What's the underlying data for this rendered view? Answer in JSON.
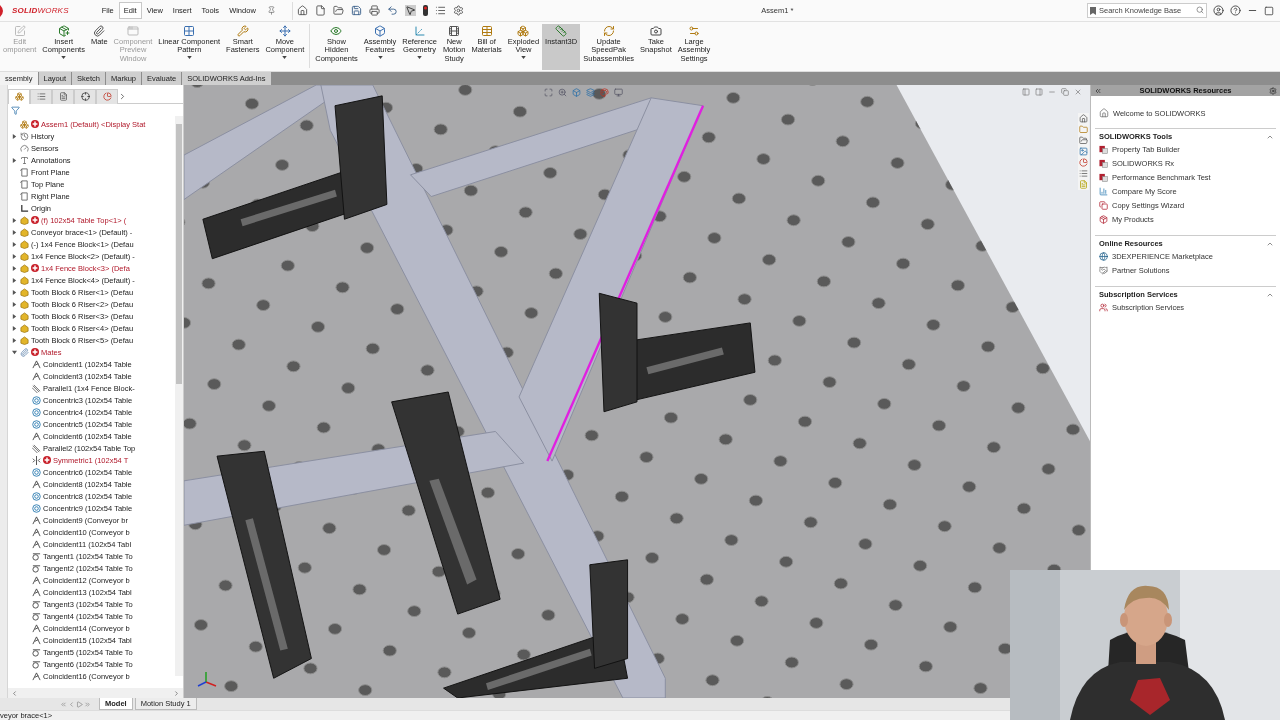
{
  "app": {
    "logo": "**SOLID**WORKS",
    "title": "Assem1 *"
  },
  "menu": [
    {
      "label": "File",
      "selected": false
    },
    {
      "label": "Edit",
      "selected": true
    },
    {
      "label": "View",
      "selected": false
    },
    {
      "label": "Insert",
      "selected": false
    },
    {
      "label": "Tools",
      "selected": false
    },
    {
      "label": "Window",
      "selected": false
    }
  ],
  "search": {
    "placeholder": "Search Knowledge Base"
  },
  "ribbon": [
    {
      "label": "Edit\nomponent",
      "disabled": true,
      "selected": false,
      "dropdown": false
    },
    {
      "label": "Insert\nComponents",
      "disabled": false,
      "selected": false,
      "dropdown": true
    },
    {
      "label": "Mate",
      "disabled": false,
      "selected": false,
      "dropdown": false
    },
    {
      "label": "Component\nPreview\nWindow",
      "disabled": true,
      "selected": false,
      "dropdown": false
    },
    {
      "label": "Linear Component\nPattern",
      "disabled": false,
      "selected": false,
      "dropdown": true
    },
    {
      "label": "Smart\nFasteners",
      "disabled": false,
      "selected": false,
      "dropdown": false
    },
    {
      "label": "Move\nComponent",
      "disabled": false,
      "selected": false,
      "dropdown": true
    },
    {
      "label": "Show\nHidden\nComponents",
      "disabled": false,
      "selected": false,
      "dropdown": false
    },
    {
      "label": "Assembly\nFeatures",
      "disabled": false,
      "selected": false,
      "dropdown": true
    },
    {
      "label": "Reference\nGeometry",
      "disabled": false,
      "selected": false,
      "dropdown": true
    },
    {
      "label": "New\nMotion\nStudy",
      "disabled": false,
      "selected": false,
      "dropdown": false
    },
    {
      "label": "Bill of\nMaterials",
      "disabled": false,
      "selected": false,
      "dropdown": false
    },
    {
      "label": "Exploded\nView",
      "disabled": false,
      "selected": false,
      "dropdown": true
    },
    {
      "label": "Instant3D",
      "disabled": false,
      "selected": true,
      "dropdown": false
    },
    {
      "label": "Update\nSpeedPak\nSubassemblies",
      "disabled": false,
      "selected": false,
      "dropdown": false
    },
    {
      "label": "Take\nSnapshot",
      "disabled": false,
      "selected": false,
      "dropdown": false
    },
    {
      "label": "Large\nAssembly\nSettings",
      "disabled": false,
      "selected": false,
      "dropdown": false
    }
  ],
  "tabs": [
    {
      "label": "ssembly",
      "selected": true
    },
    {
      "label": "Layout",
      "selected": false
    },
    {
      "label": "Sketch",
      "selected": false
    },
    {
      "label": "Markup",
      "selected": false
    },
    {
      "label": "Evaluate",
      "selected": false
    },
    {
      "label": "SOLIDWORKS Add-Ins",
      "selected": false
    }
  ],
  "tree_tabs": [
    {
      "selected": true
    },
    {
      "selected": false
    },
    {
      "selected": false
    },
    {
      "selected": false
    },
    {
      "selected": false
    }
  ],
  "tree": {
    "label": "Assem1 (Default) <Display Stat",
    "kind": "assembly",
    "error": true,
    "children": [
      {
        "label": "History",
        "kind": "history",
        "error": false,
        "expanded": false
      },
      {
        "label": "Sensors",
        "kind": "sensors",
        "error": false
      },
      {
        "label": "Annotations",
        "kind": "annotations",
        "error": false,
        "expanded": false
      },
      {
        "label": "Front Plane",
        "kind": "plane",
        "error": false
      },
      {
        "label": "Top Plane",
        "kind": "plane",
        "error": false
      },
      {
        "label": "Right Plane",
        "kind": "plane",
        "error": false
      },
      {
        "label": "Origin",
        "kind": "origin",
        "error": false
      },
      {
        "label": "(f) 102x54 Table Top<1> (",
        "kind": "part",
        "error": true,
        "expanded": false
      },
      {
        "label": "Conveyor brace<1> (Default) -",
        "kind": "part",
        "error": false,
        "expanded": false
      },
      {
        "label": "(-) 1x4 Fence Block<1> (Defau",
        "kind": "part",
        "error": false,
        "expanded": false
      },
      {
        "label": "1x4 Fence Block<2> (Default) -",
        "kind": "part",
        "error": false,
        "expanded": false
      },
      {
        "label": "1x4 Fence Block<3> (Defa",
        "kind": "part",
        "error": true,
        "expanded": false
      },
      {
        "label": "1x4 Fence Block<4> (Default) -",
        "kind": "part",
        "error": false,
        "expanded": false
      },
      {
        "label": "Tooth Block 6 Riser<1> (Defau",
        "kind": "part",
        "error": false,
        "expanded": false
      },
      {
        "label": "Tooth Block 6 Riser<2> (Defau",
        "kind": "part",
        "error": false,
        "expanded": false
      },
      {
        "label": "Tooth Block 6 Riser<3> (Defau",
        "kind": "part",
        "error": false,
        "expanded": false
      },
      {
        "label": "Tooth Block 6 Riser<4> (Defau",
        "kind": "part",
        "error": false,
        "expanded": false
      },
      {
        "label": "Tooth Block 6 Riser<5> (Defau",
        "kind": "part",
        "error": false,
        "expanded": false
      },
      {
        "label": "Mates",
        "kind": "mates",
        "error": true,
        "expanded": true,
        "children": [
          {
            "label": "Coincident1 (102x54 Table",
            "kind": "coincident",
            "error": false
          },
          {
            "label": "Coincident3 (102x54 Table",
            "kind": "coincident",
            "error": false
          },
          {
            "label": "Parallel1 (1x4 Fence Block-",
            "kind": "parallel",
            "error": false
          },
          {
            "label": "Concentric3 (102x54 Table",
            "kind": "concentric",
            "error": false
          },
          {
            "label": "Concentric4 (102x54 Table",
            "kind": "concentric",
            "error": false
          },
          {
            "label": "Concentric5 (102x54 Table",
            "kind": "concentric",
            "error": false
          },
          {
            "label": "Coincident6 (102x54 Table",
            "kind": "coincident",
            "error": false
          },
          {
            "label": "Parallel2 (102x54 Table Top",
            "kind": "parallel",
            "error": false
          },
          {
            "label": "Symmetric1 (102x54 T",
            "kind": "symmetric",
            "error": true
          },
          {
            "label": "Concentric6 (102x54 Table",
            "kind": "concentric",
            "error": false
          },
          {
            "label": "Coincident8 (102x54 Table",
            "kind": "coincident",
            "error": false
          },
          {
            "label": "Concentric8 (102x54 Table",
            "kind": "concentric",
            "error": false
          },
          {
            "label": "Concentric9 (102x54 Table",
            "kind": "concentric",
            "error": false
          },
          {
            "label": "Coincident9 (Conveyor br",
            "kind": "coincident",
            "error": false
          },
          {
            "label": "Coincident10 (Conveyor b",
            "kind": "coincident",
            "error": false
          },
          {
            "label": "Coincident11 (102x54 Tabl",
            "kind": "coincident",
            "error": false
          },
          {
            "label": "Tangent1 (102x54 Table To",
            "kind": "tangent",
            "error": false
          },
          {
            "label": "Tangent2 (102x54 Table To",
            "kind": "tangent",
            "error": false
          },
          {
            "label": "Coincident12 (Conveyor b",
            "kind": "coincident",
            "error": false
          },
          {
            "label": "Coincident13 (102x54 Tabl",
            "kind": "coincident",
            "error": false
          },
          {
            "label": "Tangent3 (102x54 Table To",
            "kind": "tangent",
            "error": false
          },
          {
            "label": "Tangent4 (102x54 Table To",
            "kind": "tangent",
            "error": false
          },
          {
            "label": "Coincident14 (Conveyor b",
            "kind": "coincident",
            "error": false
          },
          {
            "label": "Coincident15 (102x54 Tabl",
            "kind": "coincident",
            "error": false
          },
          {
            "label": "Tangent5 (102x54 Table To",
            "kind": "tangent",
            "error": false
          },
          {
            "label": "Tangent6 (102x54 Table To",
            "kind": "tangent",
            "error": false
          },
          {
            "label": "Coincident16 (Conveyor b",
            "kind": "coincident",
            "error": false
          }
        ]
      }
    ]
  },
  "bottom_tabs": [
    {
      "label": "Model",
      "selected": true
    },
    {
      "label": "Motion Study 1",
      "selected": false
    }
  ],
  "status_bar": "veyor brace<1>",
  "task_pane": {
    "title": "SOLIDWORKS Resources",
    "welcome": "Welcome to SOLIDWORKS",
    "sections": [
      {
        "title": "SOLIDWORKS Tools",
        "expanded": true,
        "items": [
          {
            "label": "Property Tab Builder",
            "kind": "tool"
          },
          {
            "label": "SOLIDWORKS Rx",
            "kind": "tool"
          },
          {
            "label": "Performance Benchmark Test",
            "kind": "tool"
          },
          {
            "label": "Compare My Score",
            "kind": "score"
          },
          {
            "label": "Copy Settings Wizard",
            "kind": "wizard"
          },
          {
            "label": "My Products",
            "kind": "products"
          }
        ]
      },
      {
        "title": "Online Resources",
        "expanded": true,
        "items": [
          {
            "label": "3DEXPERIENCE Marketplace",
            "kind": "globe"
          },
          {
            "label": "Partner Solutions",
            "kind": "partner"
          }
        ]
      },
      {
        "title": "Subscription Services",
        "expanded": true,
        "items": [
          {
            "label": "Subscription Services",
            "kind": "subscription"
          }
        ]
      }
    ]
  }
}
